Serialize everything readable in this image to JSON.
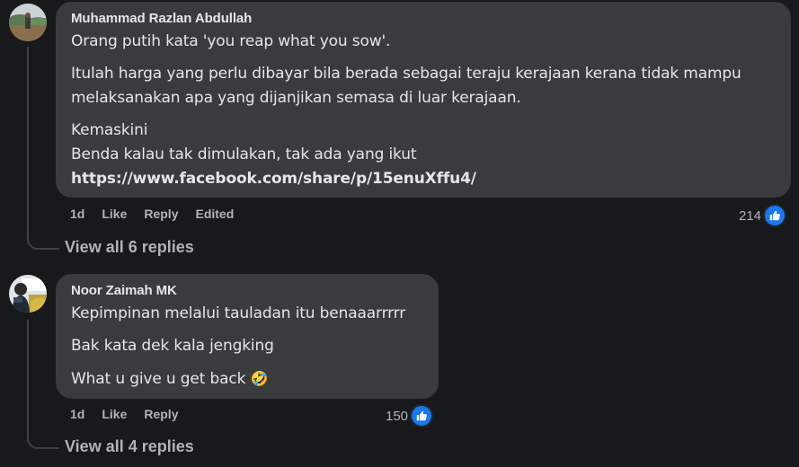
{
  "comments": [
    {
      "author": "Muhammad Razlan Abdullah",
      "paragraphs": [
        [
          "Orang putih kata 'you reap what you sow'."
        ],
        [
          "Itulah harga yang perlu dibayar bila berada sebagai teraju kerajaan kerana tidak mampu",
          "melaksanakan apa yang dijanjikan semasa di luar kerajaan."
        ],
        [
          "Kemaskini",
          "Benda kalau tak dimulakan, tak ada yang ikut"
        ]
      ],
      "link": "https://www.facebook.com/share/p/15enuXffu4/",
      "time": "1d",
      "like_label": "Like",
      "reply_label": "Reply",
      "edited_label": "Edited",
      "reaction_count": "214",
      "reaction_icon": "thumbs-up-icon",
      "view_replies": "View all 6 replies"
    },
    {
      "author": "Noor Zaimah MK",
      "paragraphs": [
        [
          "Kepimpinan melalui tauladan itu benaaarrrrr"
        ],
        [
          "Bak kata dek kala jengking"
        ],
        [
          "What u give u get back"
        ]
      ],
      "emoji": "🤣",
      "time": "1d",
      "like_label": "Like",
      "reply_label": "Reply",
      "reaction_count": "150",
      "reaction_icon": "thumbs-up-icon",
      "view_replies": "View all 4 replies"
    }
  ],
  "colors": {
    "background": "#18191a",
    "bubble": "#3a3b3c",
    "text": "#e4e6eb",
    "secondary_text": "#b0b3b8",
    "like_blue": "#1877f2"
  }
}
